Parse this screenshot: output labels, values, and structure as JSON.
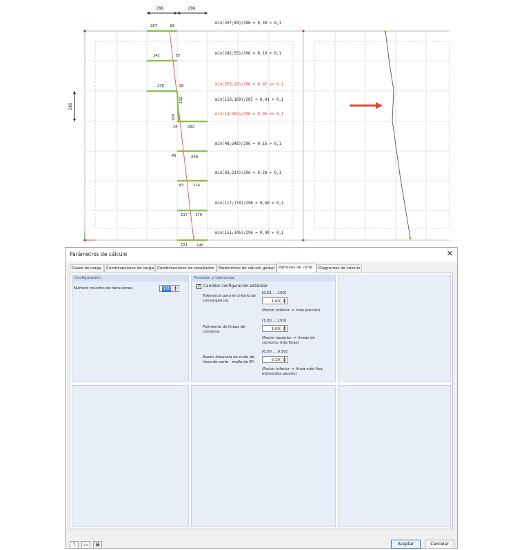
{
  "figure": {
    "top_dims": [
      "296",
      "296"
    ],
    "left_dim": "285",
    "levels": [
      {
        "left": "207",
        "right": "89",
        "formula": "min(207;89)/296 = 0,30 > 0,1",
        "warn": false
      },
      {
        "left": "242",
        "right": "55",
        "formula": "min(242;55)/296 = 0,19 > 0,1",
        "warn": false
      },
      {
        "left": "276",
        "right": "20",
        "formula": "min(276;20)/296 = 0,07 <= 0,1",
        "warn": true
      },
      {
        "left": "116",
        "right": "169",
        "formula": "min(116;169)/285 = 0,41 > 0,1",
        "warn": false
      },
      {
        "left": "14",
        "right": "282",
        "formula": "min(14;282)/296 = 0,05 <= 0,1",
        "warn": true
      },
      {
        "left": "48",
        "right": "248",
        "formula": "min(48;248)/296 = 0,16 > 0,1",
        "warn": false
      },
      {
        "left": "83",
        "right": "214",
        "formula": "min(83;214)/296 = 0,28 > 0,1",
        "warn": false
      },
      {
        "left": "117",
        "right": "179",
        "formula": "min(117;179)/296 = 0,40 > 0,1",
        "warn": false
      },
      {
        "left": "151",
        "right": "145",
        "formula": "min(151;145)/296 = 0,49 > 0,1",
        "warn": false
      }
    ],
    "colors": {
      "green": "#8cc152",
      "red": "#e03a2f",
      "grid": "#d0d0d0"
    }
  },
  "dialog": {
    "title": "Parámetros de cálculo",
    "close_label": "✕",
    "tabs": [
      "Casos de carga",
      "Combinaciones de carga",
      "Combinaciones de resultados",
      "Parámetros de cálculo global",
      "Patrones de corte",
      "Diagramas de cálculo"
    ],
    "active_tab": "Patrones de corte",
    "config": {
      "header": "Configuración",
      "max_iter_label": "Número máximo de iteraciones:",
      "max_iter_value": "100"
    },
    "precision": {
      "header": "Precisión y tolerancia",
      "change_label": "Cambiar configuración estándar",
      "change_checked": "✓",
      "tolerance_label_1": "Tolerancia para el criterio de",
      "tolerance_label_2": "convergencia:",
      "tolerance_range": "[0.01 ... 100]",
      "tolerance_value": "1.00",
      "tolerance_note": "(Factor inferior -> más preciso)",
      "smoothing_label_1": "Pulimento de líneas de",
      "smoothing_label_2": "contorno:",
      "smoothing_range": "[1.00 ... 100]",
      "smoothing_value": "1.00",
      "smoothing_note_1": "(Factor superior -> líneas de",
      "smoothing_note_2": "contorno más finas)",
      "ratio_label_1": "Razón distancia de nudo de",
      "ratio_label_2": "línea de corte - malla de EF:",
      "ratio_range": "[0.00 ... 0.50]",
      "ratio_value": "0.10",
      "ratio_note_1": "(Factor inferior -> línea más fina,",
      "ratio_note_2": "elementos peores)"
    },
    "buttons": {
      "ok": "Aceptar",
      "cancel": "Cancelar"
    }
  }
}
